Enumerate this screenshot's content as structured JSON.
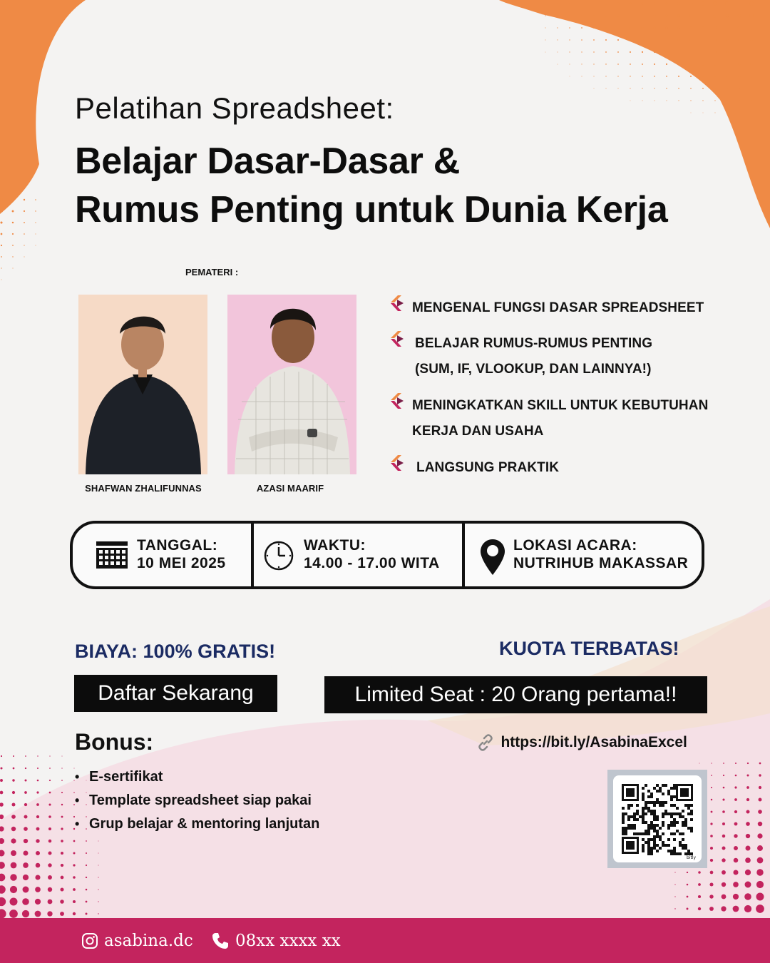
{
  "header": {
    "subtitle": "Pelatihan Spreadsheet:",
    "title_line1": "Belajar Dasar-Dasar &",
    "title_line2": "Rumus Penting untuk Dunia Kerja"
  },
  "speakers": {
    "label": "PEMATERI :",
    "items": [
      {
        "name": "SHAFWAN ZHALIFUNNAS"
      },
      {
        "name": "AZASI MAARIF"
      }
    ]
  },
  "points": [
    {
      "text": "MENGENAL FUNGSI DASAR SPREADSHEET"
    },
    {
      "text": "BELAJAR RUMUS-RUMUS PENTING",
      "text2": "(SUM, IF, VLOOKUP, DAN LAINNYA!)"
    },
    {
      "text": "MENINGKATKAN SKILL UNTUK KEBUTUHAN",
      "text2": "KERJA DAN USAHA"
    },
    {
      "text": "LANGSUNG PRAKTIK"
    }
  ],
  "info": {
    "date_label": "TANGGAL:",
    "date_value": "10 MEI 2025",
    "time_label": "WAKTU:",
    "time_value": "14.00 - 17.00 WITA",
    "location_label": "LOKASI ACARA:",
    "location_value": "NUTRIHUB MAKASSAR"
  },
  "registration": {
    "cost": "BIAYA: 100% GRATIS!",
    "register_button": "Daftar Sekarang",
    "quota": "KUOTA TERBATAS!",
    "seat_banner": "Limited Seat : 20 Orang pertama!!",
    "link": "https://bit.ly/AsabinaExcel"
  },
  "bonus": {
    "title": "Bonus:",
    "items": [
      "E-sertifikat",
      "Template spreadsheet siap pakai",
      "Grup belajar & mentoring lanjutan"
    ]
  },
  "qr": {
    "brand": "bitly"
  },
  "footer": {
    "instagram": "asabina.dc",
    "phone": "08xx xxxx xx"
  },
  "colors": {
    "orange": "#ef8a45",
    "magenta": "#c3245e",
    "navy": "#1b2b63",
    "pink_wash": "#f6d9e2"
  }
}
